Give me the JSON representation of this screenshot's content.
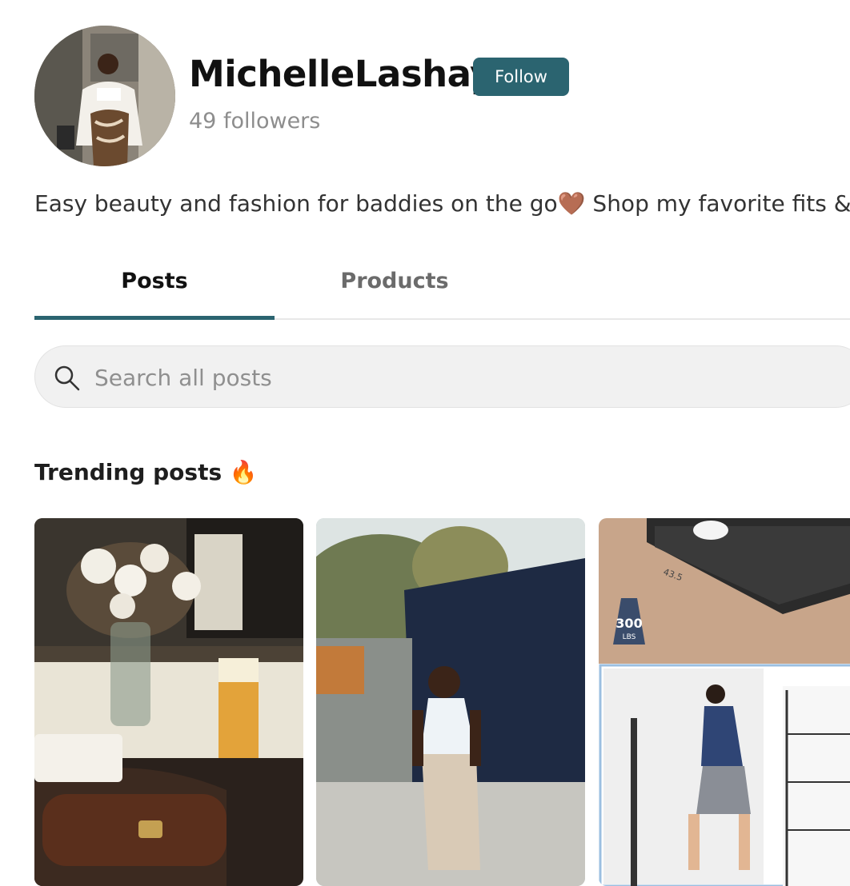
{
  "profile": {
    "username": "MichelleLashay",
    "follow_label": "Follow",
    "followers": "49 followers",
    "bio": "Easy beauty and fashion for baddies on the go🤎 Shop my favorite fits &"
  },
  "tabs": [
    {
      "label": "Posts",
      "active": true
    },
    {
      "label": "Products",
      "active": false
    }
  ],
  "search": {
    "placeholder": "Search all posts"
  },
  "trending": {
    "title": "Trending posts 🔥"
  },
  "posts": [
    {
      "icon": "dinner-table-photo"
    },
    {
      "icon": "woman-outfit-photo"
    },
    {
      "icon": "walking-pad-product-photo",
      "badge_value": "300",
      "badge_unit": "LBS",
      "tread_marking": "43.5"
    }
  ],
  "colors": {
    "accent": "#2b6470",
    "text_muted": "#8d8d8d",
    "search_bg": "#f1f1f1"
  }
}
